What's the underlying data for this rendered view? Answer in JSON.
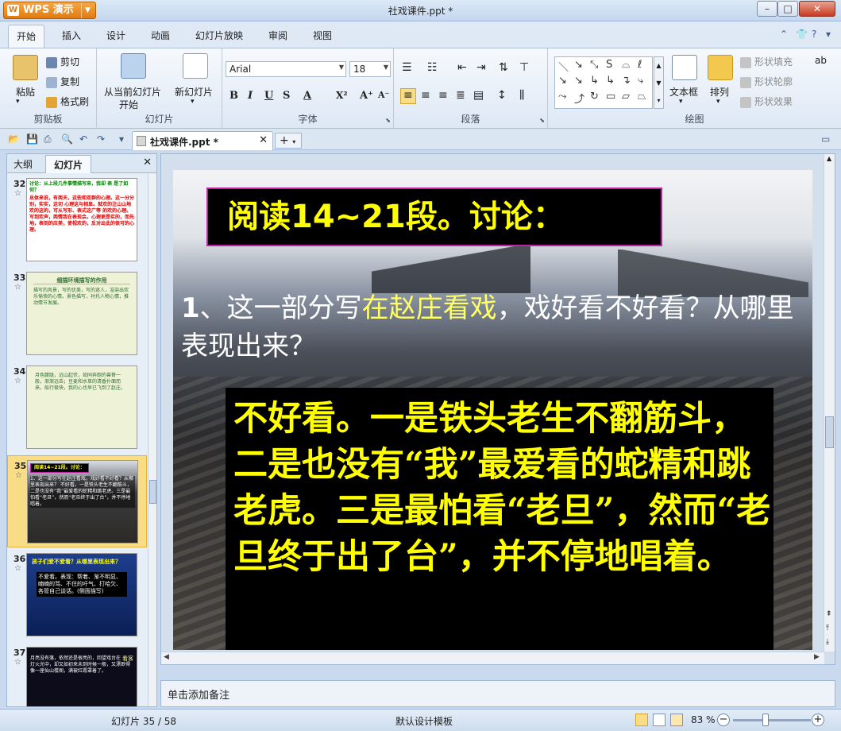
{
  "app": {
    "menu_button": "WPS 演示",
    "window_title": "社戏课件.ppt *"
  },
  "window_controls": {
    "minimize": "–",
    "maximize": "□",
    "close": "✕"
  },
  "menu_tabs": [
    "开始",
    "插入",
    "设计",
    "动画",
    "幻灯片放映",
    "审阅",
    "视图"
  ],
  "ribbon": {
    "clipboard": {
      "paste": "粘贴",
      "cut": "剪切",
      "copy": "复制",
      "format_painter": "格式刷",
      "label": "剪贴板"
    },
    "slides": {
      "from_current": "从当前幻灯片",
      "start": "开始",
      "new_slide": "新幻灯片",
      "label": "幻灯片"
    },
    "font": {
      "name": "Arial",
      "size": "18",
      "label": "字体",
      "bold": "B",
      "italic": "I",
      "underline": "U",
      "shadow": "S",
      "color": "A",
      "superscript": "X²",
      "grow": "A⁺",
      "shrink": "A⁻"
    },
    "paragraph": {
      "label": "段落"
    },
    "drawing": {
      "textbox": "文本框",
      "arrange": "排列",
      "shape_fill": "形状填充",
      "shape_outline": "形状轮廓",
      "shape_effect": "形状效果",
      "label": "绘图"
    }
  },
  "document_tab": {
    "name": "社戏课件.ppt *"
  },
  "left_panel": {
    "tab_outline": "大纲",
    "tab_slides": "幻灯片",
    "thumbnails": [
      {
        "num": "32",
        "title": "讨论：从上段几件事情描写来，我却 表 是了如何？",
        "body": "总体来说，有两天，这些和双群的心理。这一分分别，实实，这切 心理这与相显。就欢的注山山地欢的这的，可从写形、表式这广等 的欢的心理。写到欢声，两情我在表现会。心理更是实的，而先地，表到的应美，使视欢的，反对出此的很可的心理。",
        "theme": "white"
      },
      {
        "num": "33",
        "title": "细描环境描写的作用",
        "body": "描写的风景，写的优美，写的迷人，渲染出欢乐愉快的心情。景色描写，衬托人物心情，推动情节发展。",
        "theme": "green"
      },
      {
        "num": "34",
        "title": "",
        "body": "月色朦胧，远山起伏，如同奔跑的兽脊一般，渐渐远去；豆麦和水草的清香扑面而来。船行极快，我的心也早已飞到了赵庄。",
        "theme": "green"
      },
      {
        "num": "35",
        "title": "阅读14~21段。讨论：",
        "body": "1、这一部分写在赵庄看戏，戏好看不好看？从哪里表现出来？ 不好看。一是铁头老生不翻筋斗，二是也没有“我”最爱看的蛇精和跳老虎。三是最怕看“老旦”，然而“老旦终于出了台”，并不停地唱着。",
        "theme": "dark"
      },
      {
        "num": "36",
        "title": "孩子们爱不爱看？从哪里表现出来？",
        "body": "不爱看。表现：帮着、渐不明显、喃喃的骂、不住的吁气、打哈欠、各管自己谈话。(侧面描写)",
        "theme": "blue"
      },
      {
        "num": "37",
        "title": "看客",
        "body": "月亮没有落，依然还是很亮的，回望戏台在灯火光中，却又如初来未到时候一般，又漂渺得像一座仙山楼阁，满被红霞罩着了。",
        "theme": "night"
      }
    ]
  },
  "slide": {
    "title": "阅读14~21段。讨论：",
    "question_num": "1",
    "question_a": "、这一部分写",
    "question_hl": "在赵庄看戏",
    "question_b": "，戏好看不好看？从哪里表现出来？",
    "answer": "不好看。一是铁头老生不翻筋斗，二是也没有“我”最爱看的蛇精和跳老虎。三是最怕看“老旦”，然而“老旦终于出了台”，并不停地唱着。"
  },
  "notes_placeholder": "单击添加备注",
  "status": {
    "slide_counter": "幻灯片 35 / 58",
    "template": "默认设计模板",
    "zoom": "83 %"
  },
  "colors": {
    "accent_orange": "#e07b10",
    "title_text": "#ffff00",
    "title_border": "#c020a8",
    "ribbon_bg": "#dde8f5"
  }
}
